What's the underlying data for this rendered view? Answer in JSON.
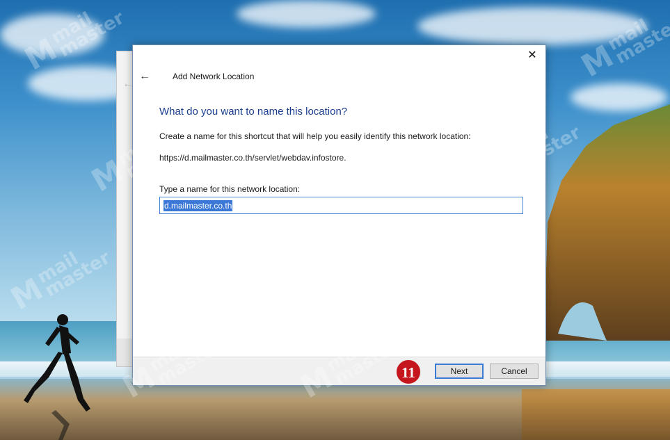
{
  "wizard": {
    "title": "Add Network Location",
    "close_glyph": "✕",
    "back_glyph": "←",
    "heading": "What do you want to name this location?",
    "description": "Create a name for this shortcut that will help you easily identify this network location:",
    "url": "https://d.mailmaster.co.th/servlet/webdav.infostore.",
    "name_label": "Type a name for this network location:",
    "name_value": "d.mailmaster.co.th",
    "step_badge": "11",
    "next_label": "Next",
    "cancel_label": "Cancel"
  },
  "background_window": {
    "back_glyph": "←"
  },
  "watermark": {
    "logo_glyph": "M",
    "line1": "mail",
    "line2": "master"
  },
  "colors": {
    "heading": "#1a3e8f",
    "selection": "#3a77d7",
    "step_badge": "#c4161c",
    "focus_border": "#3c7bd5"
  }
}
